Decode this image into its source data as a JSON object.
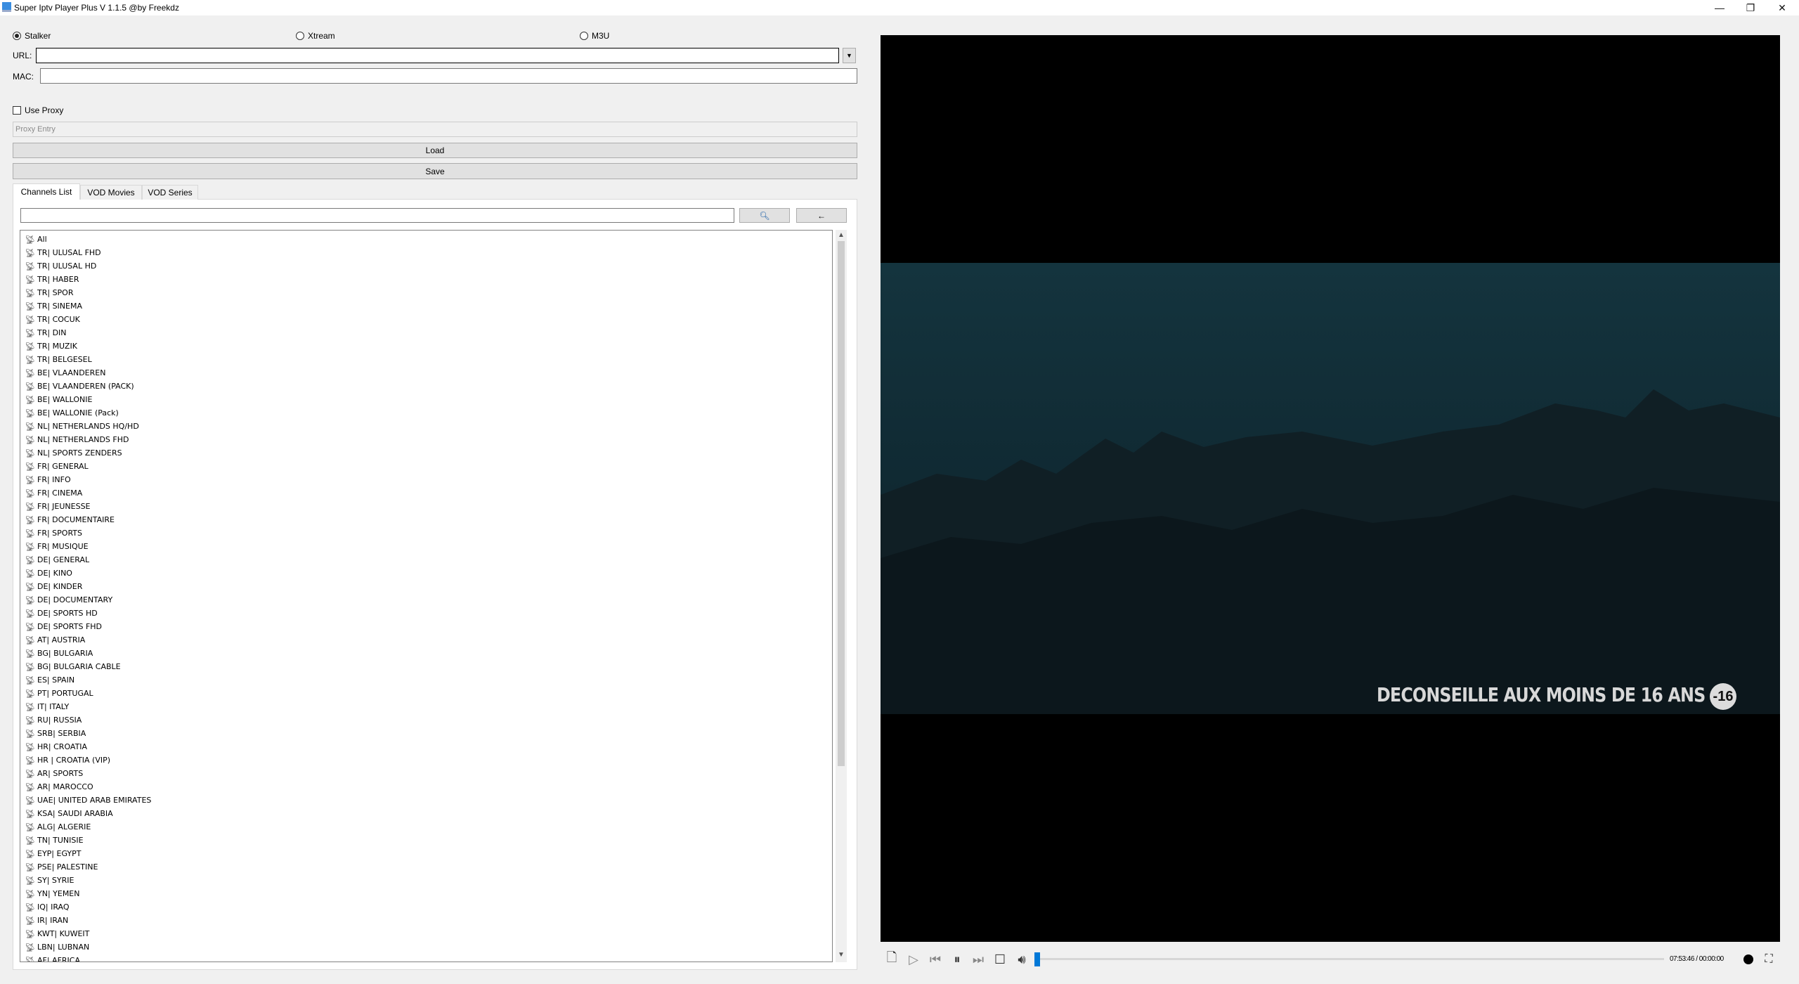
{
  "window": {
    "title": "Super Iptv Player Plus V 1.1.5 @by Freekdz",
    "minimize": "—",
    "maximize": "❐",
    "close": "✕"
  },
  "source": {
    "options": [
      {
        "label": "Stalker",
        "selected": true
      },
      {
        "label": "Xtream",
        "selected": false
      },
      {
        "label": "M3U",
        "selected": false
      }
    ]
  },
  "form": {
    "url_label": "URL:",
    "url_value": "",
    "mac_label": "MAC:",
    "mac_value": "",
    "use_proxy_label": "Use Proxy",
    "use_proxy_checked": false,
    "proxy_placeholder": "Proxy Entry",
    "load_label": "Load",
    "save_label": "Save"
  },
  "tabs": [
    {
      "label": "Channels List",
      "active": true
    },
    {
      "label": "VOD Movies",
      "active": false
    },
    {
      "label": "VOD Series",
      "active": false
    }
  ],
  "search": {
    "value": "",
    "search_icon": "magnifier-icon",
    "back_label": "←"
  },
  "channels": [
    "All",
    "TR| ULUSAL FHD",
    "TR| ULUSAL HD",
    "TR| HABER",
    "TR| SPOR",
    "TR| SINEMA",
    "TR| COCUK",
    "TR| DIN",
    "TR| MUZIK",
    "TR| BELGESEL",
    "BE| VLAANDEREN",
    "BE| VLAANDEREN (PACK)",
    "BE| WALLONIE",
    "BE| WALLONIE (Pack)",
    "NL| NETHERLANDS HQ/HD",
    "NL| NETHERLANDS FHD",
    "NL| SPORTS ZENDERS",
    "FR| GENERAL",
    "FR| INFO",
    "FR| CINEMA",
    "FR| JEUNESSE",
    "FR| DOCUMENTAIRE",
    "FR| SPORTS",
    "FR| MUSIQUE",
    "DE| GENERAL",
    "DE| KINO",
    "DE| KINDER",
    "DE| DOCUMENTARY",
    "DE| SPORTS HD",
    "DE| SPORTS FHD",
    "AT| AUSTRIA",
    "BG| BULGARIA",
    "BG| BULGARIA CABLE",
    "ES| SPAIN",
    "PT| PORTUGAL",
    "IT| ITALY",
    "RU| RUSSIA",
    "SRB| SERBIA",
    "HR| CROATIA",
    "HR | CROATIA (VIP)",
    "AR| SPORTS",
    "AR| MAROCCO",
    "UAE| UNITED ARAB EMIRATES",
    "KSA| SAUDI ARABIA",
    "ALG| ALGERIE",
    "TN| TUNISIE",
    "EYP| EGYPT",
    "PSE| PALESTINE",
    "SY| SYRIE",
    "YN| YEMEN",
    "IQ| IRAQ",
    "IR| IRAN",
    "KWT| KUWEIT",
    "LBN| LUBNAN",
    "AF| AFRICA"
  ],
  "video": {
    "overlay_text": "DECONSEILLE AUX MOINS DE 16 ANS",
    "rating_badge": "-16"
  },
  "player": {
    "time": "07:53:46 / 00:00:00",
    "progress": 0,
    "accent": "#0078d7"
  }
}
